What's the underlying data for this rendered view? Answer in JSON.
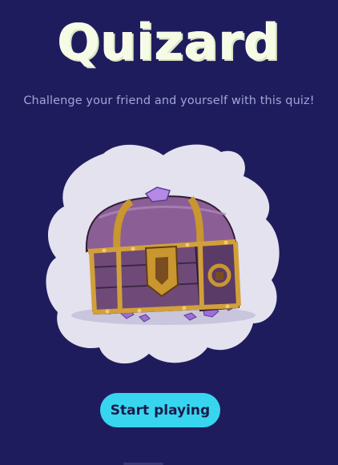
{
  "app": {
    "title": "Quizard",
    "subtitle": "Challenge your friend and yourself with this quiz!"
  },
  "hero": {
    "image": "treasure-chest-illustration"
  },
  "actions": {
    "start_label": "Start playing"
  },
  "colors": {
    "background": "#1f1c5e",
    "title": "#f6fbe6",
    "subtitle": "#9fa6d3",
    "blob": "#e3e2ee",
    "button": "#37d6ee",
    "button_text": "#1b1a4d"
  }
}
